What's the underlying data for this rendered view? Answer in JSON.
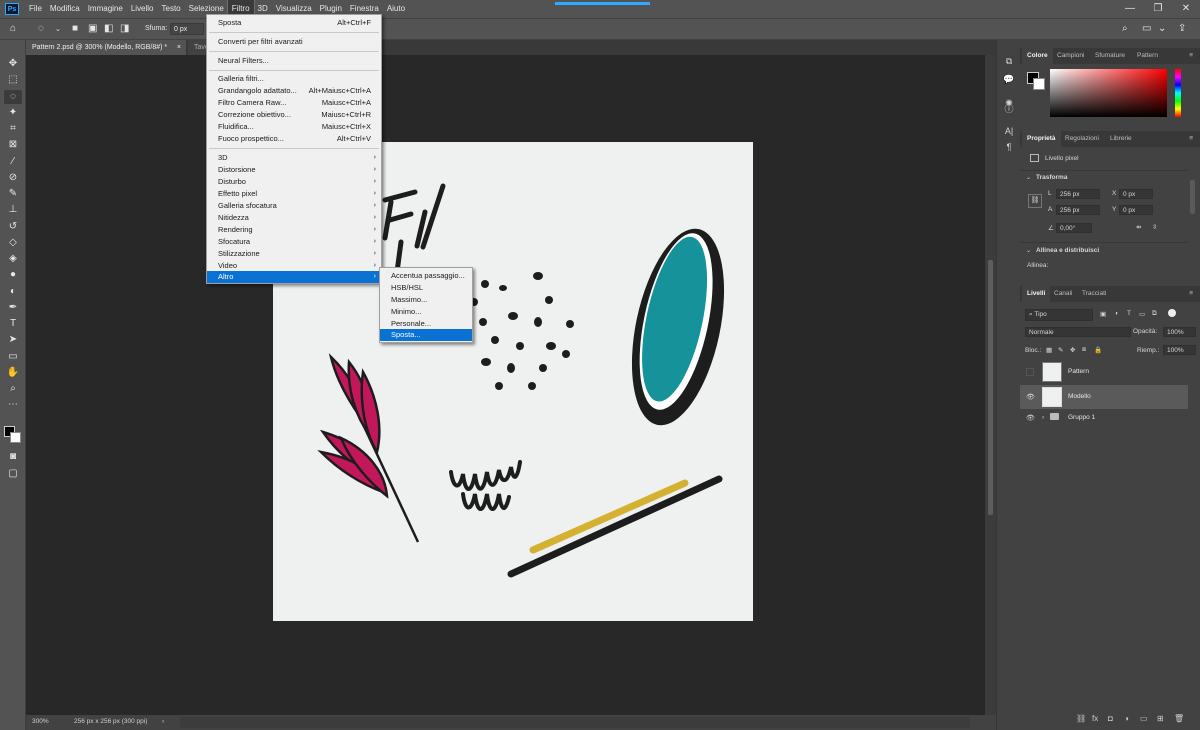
{
  "app": {
    "logo": "Ps"
  },
  "menubar": {
    "items": [
      "File",
      "Modifica",
      "Immagine",
      "Livello",
      "Testo",
      "Selezione",
      "Filtro",
      "3D",
      "Visualizza",
      "Plugin",
      "Finestra",
      "Aiuto"
    ],
    "active": "Filtro",
    "window_controls": [
      "—",
      "❐",
      "✕"
    ]
  },
  "optionsbar": {
    "feather_label": "Sfuma:",
    "feather_value": "0 px"
  },
  "tabs": {
    "doc_tab": "Pattern 2.psd @ 300% (Modello, RGB/8#) *",
    "close": "×",
    "second_tab": "Tavo"
  },
  "status": {
    "zoom": "300%",
    "doc_size": "256 px x 256 px (300 ppi)",
    "arrow": "›"
  },
  "filter_menu": {
    "items": [
      {
        "label": "Sposta",
        "shortcut": "Alt+Ctrl+F"
      },
      {
        "label": "Converti per filtri avanzati",
        "shortcut": ""
      },
      {
        "label": "Neural Filters...",
        "shortcut": ""
      },
      {
        "label": "Galleria filtri...",
        "shortcut": ""
      },
      {
        "label": "Grandangolo adattato...",
        "shortcut": "Alt+Maiusc+Ctrl+A"
      },
      {
        "label": "Filtro Camera Raw...",
        "shortcut": "Maiusc+Ctrl+A"
      },
      {
        "label": "Correzione obiettivo...",
        "shortcut": "Maiusc+Ctrl+R"
      },
      {
        "label": "Fluidifica...",
        "shortcut": "Maiusc+Ctrl+X"
      },
      {
        "label": "Fuoco prospettico...",
        "shortcut": "Alt+Ctrl+V"
      },
      {
        "label": "3D",
        "shortcut": ""
      },
      {
        "label": "Distorsione",
        "shortcut": ""
      },
      {
        "label": "Disturbo",
        "shortcut": ""
      },
      {
        "label": "Effetto pixel",
        "shortcut": ""
      },
      {
        "label": "Galleria sfocatura",
        "shortcut": ""
      },
      {
        "label": "Nitidezza",
        "shortcut": ""
      },
      {
        "label": "Rendering",
        "shortcut": ""
      },
      {
        "label": "Sfocatura",
        "shortcut": ""
      },
      {
        "label": "Stilizzazione",
        "shortcut": ""
      },
      {
        "label": "Video",
        "shortcut": ""
      },
      {
        "label": "Altro",
        "shortcut": ""
      }
    ],
    "submenu_arrow": "›"
  },
  "altro_submenu": {
    "items": [
      "Accentua passaggio...",
      "HSB/HSL",
      "Massimo...",
      "Minimo...",
      "Personale...",
      "Sposta..."
    ],
    "highlighted": "Sposta..."
  },
  "color_panel": {
    "tabs": [
      "Colore",
      "Campioni",
      "Sfumature",
      "Pattern"
    ],
    "menu": "≡"
  },
  "properties_panel": {
    "tabs": [
      "Proprietà",
      "Regolazioni",
      "Librerie"
    ],
    "menu": "≡",
    "layer_type": "Livello pixel",
    "transform_header": "Trasforma",
    "w_label": "L",
    "w_value": "256 px",
    "h_label": "A",
    "h_value": "256 px",
    "x_label": "X",
    "x_value": "0 px",
    "y_label": "Y",
    "y_value": "0 px",
    "angle_value": "0,00°",
    "align_header": "Allinea e distribuisci",
    "align_label": "Allinea:"
  },
  "layers_panel": {
    "tabs": [
      "Livelli",
      "Canali",
      "Tracciati"
    ],
    "menu": "≡",
    "filter_kind": "Tipo",
    "blend_mode": "Normale",
    "opacity_label": "Opacità:",
    "opacity_value": "100%",
    "lock_label": "Bloc.:",
    "fill_label": "Riemp.:",
    "fill_value": "100%",
    "layers": [
      "Pattern",
      "Modello",
      "Gruppo 1"
    ],
    "eye": "👁",
    "bottom_icons": [
      "⛓",
      "fx",
      "◘",
      "◑",
      "▭",
      "⊞",
      "🗑"
    ]
  },
  "colors": {
    "menubar": "#535353",
    "highlight": "#0a72d3",
    "teal": "#16939a",
    "magenta": "#c2185b",
    "gold": "#d4b130",
    "ink": "#1d1d1d"
  }
}
